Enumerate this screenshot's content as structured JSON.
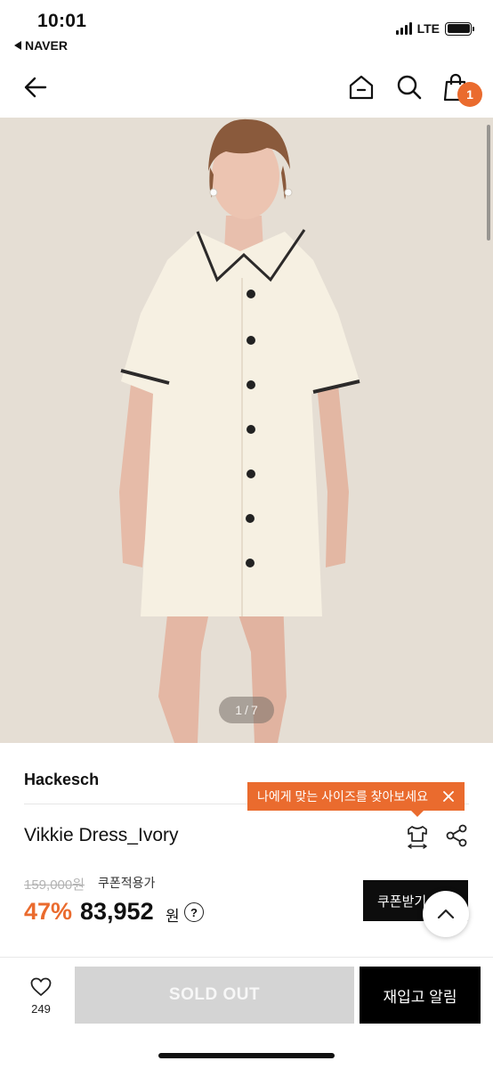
{
  "status_bar": {
    "time": "10:01",
    "back_app": "NAVER",
    "network": "LTE"
  },
  "header": {
    "cart_count": "1",
    "icons": [
      "back-arrow-icon",
      "home-icon",
      "search-icon",
      "shopping-bag-icon"
    ]
  },
  "gallery": {
    "current": "1",
    "separator": "/",
    "total": "7"
  },
  "product": {
    "brand": "Hackesch",
    "name": "Vikkie Dress_Ivory",
    "original_price": "159,000원",
    "coupon_label": "쿠폰적용가",
    "discount": "47%",
    "price": "83,952",
    "currency": "원",
    "info_icon": "?"
  },
  "tooltip": {
    "text": "나에게 맞는 사이즈를 찾아보세요"
  },
  "actions": {
    "coupon_button": "쿠폰받기",
    "like_count": "249",
    "sold_out": "SOLD OUT",
    "restock_alert": "재입고 알림"
  },
  "colors": {
    "accent": "#ea6b2e",
    "disabled": "#d4d4d4",
    "primary_button": "#000000"
  }
}
